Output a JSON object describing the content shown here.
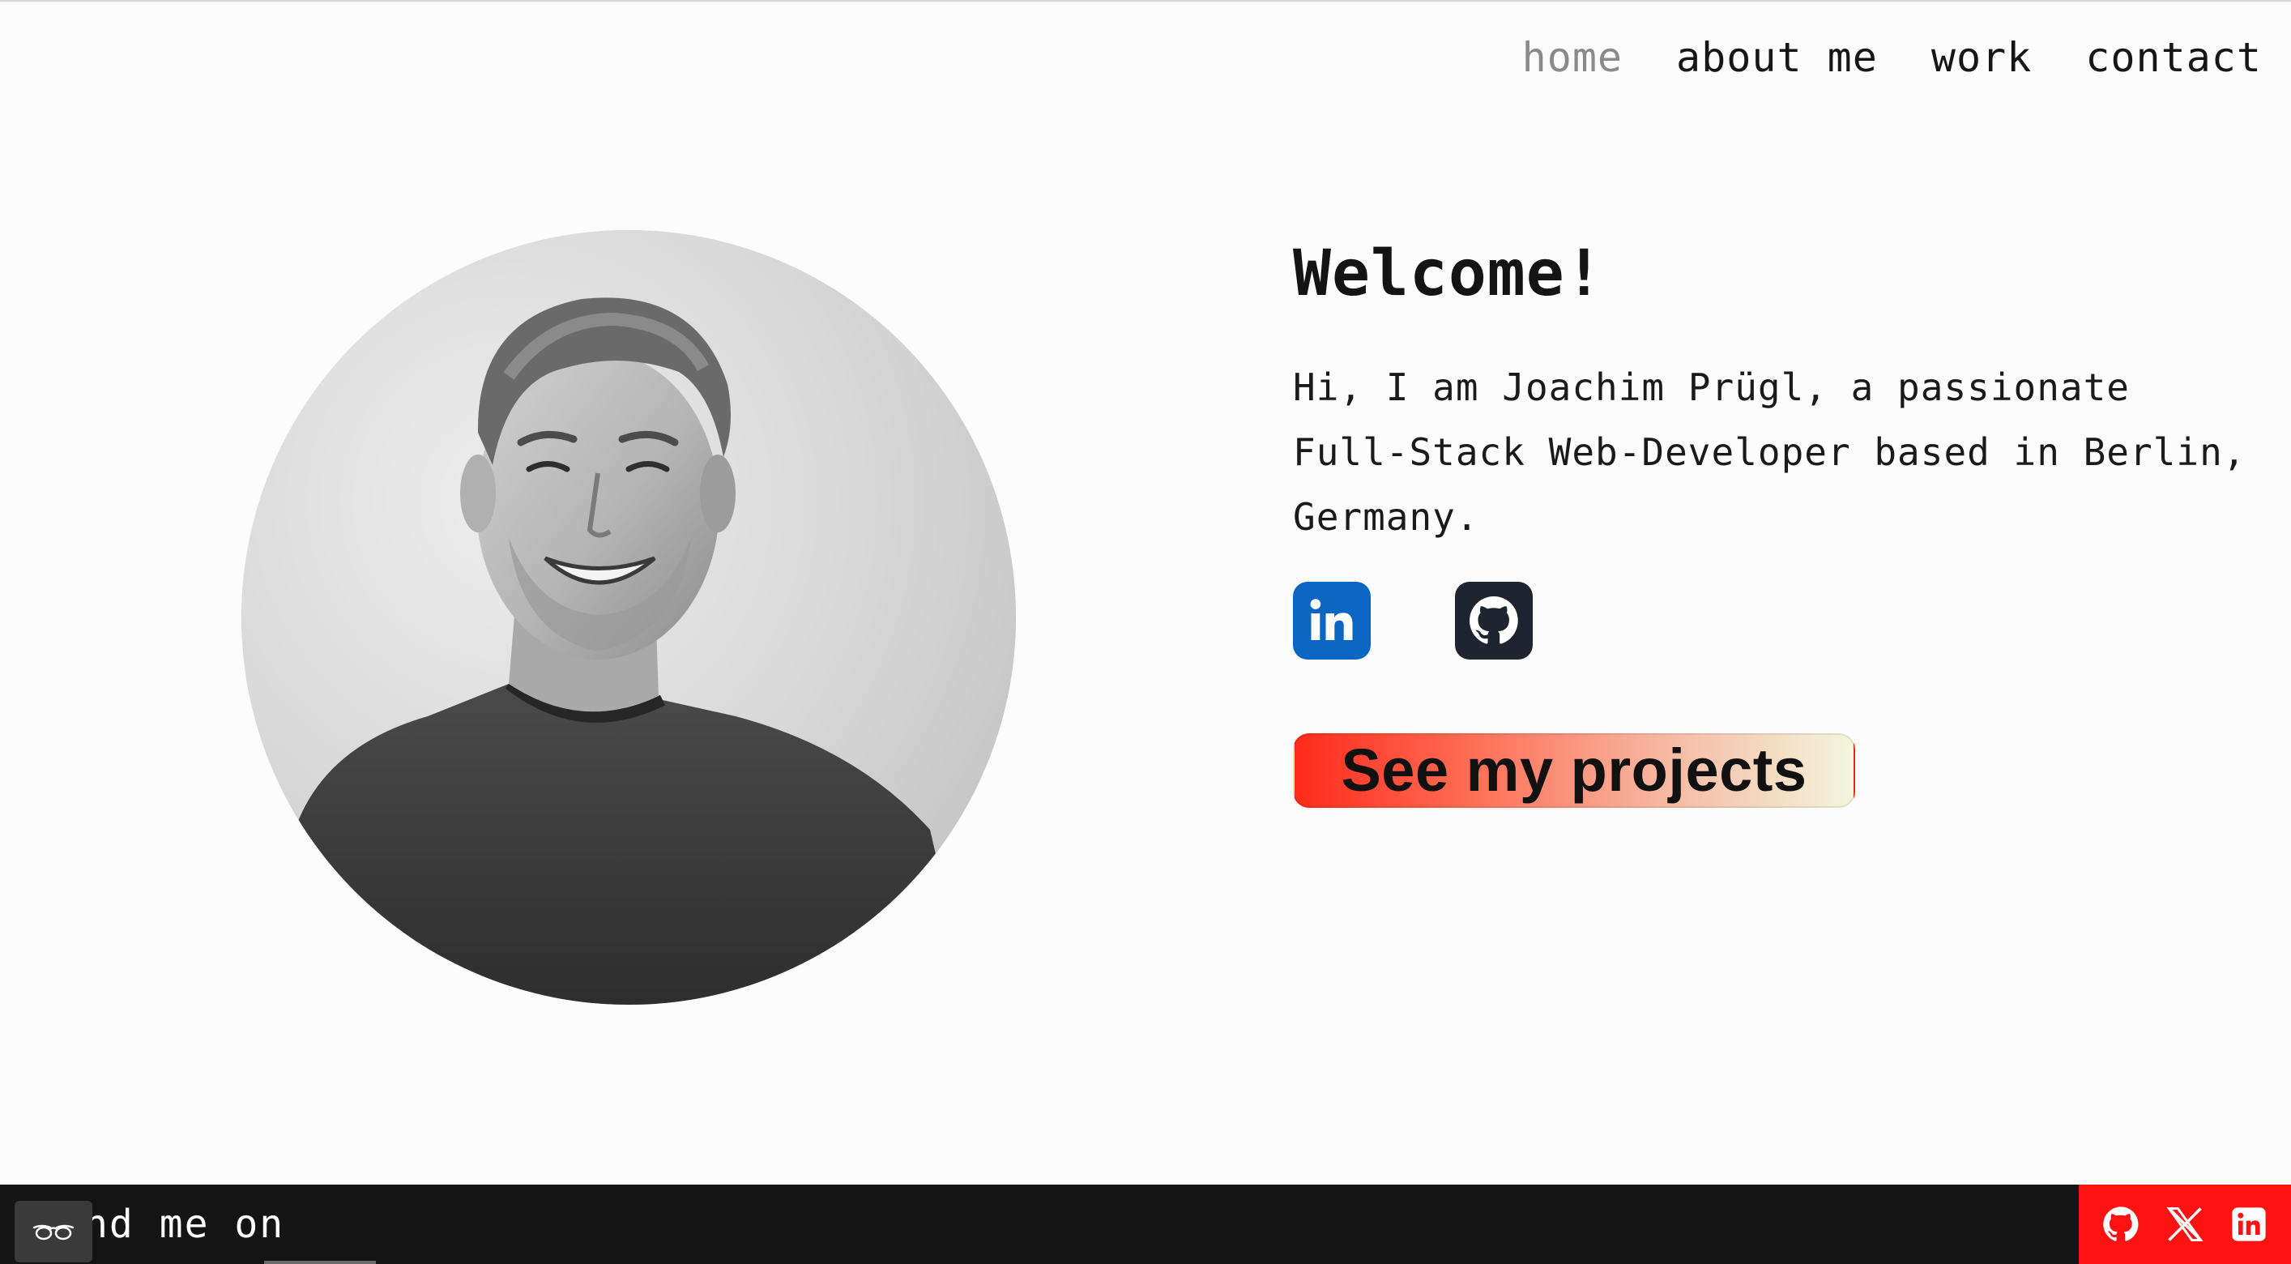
{
  "nav": {
    "items": [
      {
        "label": "home",
        "active": true
      },
      {
        "label": "about me",
        "active": false
      },
      {
        "label": "work",
        "active": false
      },
      {
        "label": "contact",
        "active": false
      }
    ]
  },
  "hero": {
    "title": "Welcome!",
    "intro": "Hi, I am Joachim Prügl, a passionate Full-Stack Web-Developer based in Berlin, Germany.",
    "social_icons": [
      "linkedin-icon",
      "github-icon"
    ],
    "cta_label": "See my projects"
  },
  "footer": {
    "marquee_text": "nd me on",
    "social_icons": [
      "github-icon",
      "x-icon",
      "linkedin-icon"
    ]
  },
  "colors": {
    "background": "#fcfcfc",
    "text": "#161616",
    "nav_active": "#8a8a8a",
    "linkedin": "#0a66c2",
    "github": "#1e2430",
    "cta_gradient_start": "#ff2a1a",
    "cta_gradient_end": "#f2f6dc",
    "footer_bg": "#141414",
    "footer_social_bg": "#ff1212"
  }
}
